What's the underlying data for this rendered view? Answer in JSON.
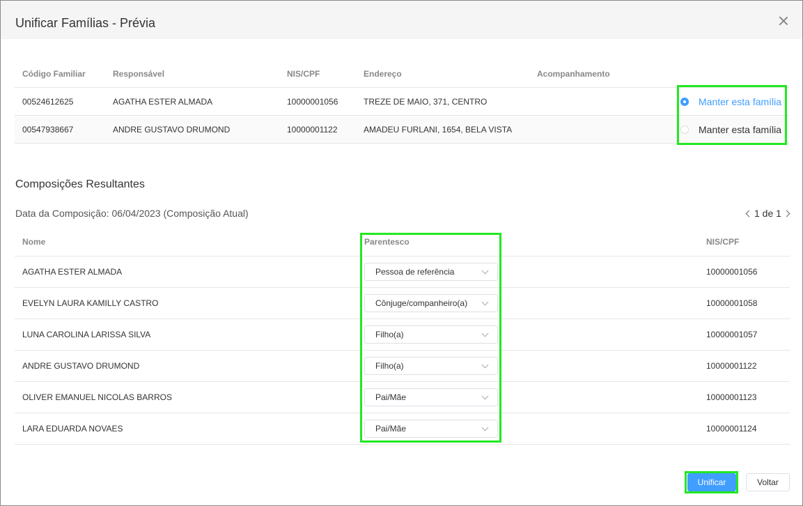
{
  "dialog": {
    "title": "Unificar Famílias - Prévia"
  },
  "families": {
    "headers": {
      "code": "Código Familiar",
      "responsible": "Responsável",
      "nis": "NIS/CPF",
      "address": "Endereço",
      "tracking": "Acompanhamento"
    },
    "rows": [
      {
        "code": "00524612625",
        "responsible": "AGATHA ESTER ALMADA",
        "nis": "10000001056",
        "address": "TREZE DE MAIO, 371, CENTRO",
        "tracking": "",
        "keep_label": "Manter esta família",
        "selected": true
      },
      {
        "code": "00547938667",
        "responsible": "ANDRE GUSTAVO DRUMOND",
        "nis": "10000001122",
        "address": "AMADEU FURLANI, 1654, BELA VISTA",
        "tracking": "",
        "keep_label": "Manter esta família",
        "selected": false
      }
    ]
  },
  "compositions": {
    "title": "Composições Resultantes",
    "date_label": "Data da Composição: 06/04/2023 (Composição Atual)",
    "pager": "1 de 1",
    "headers": {
      "name": "Nome",
      "relation": "Parentesco",
      "nis": "NIS/CPF"
    },
    "members": [
      {
        "name": "AGATHA ESTER ALMADA",
        "relation": "Pessoa de referência",
        "nis": "10000001056"
      },
      {
        "name": "EVELYN LAURA KAMILLY CASTRO",
        "relation": "Cônjuge/companheiro(a)",
        "nis": "10000001058"
      },
      {
        "name": "LUNA CAROLINA LARISSA SILVA",
        "relation": "Filho(a)",
        "nis": "10000001057"
      },
      {
        "name": "ANDRE GUSTAVO DRUMOND",
        "relation": "Filho(a)",
        "nis": "10000001122"
      },
      {
        "name": "OLIVER EMANUEL NICOLAS BARROS",
        "relation": "Pai/Mãe",
        "nis": "10000001123"
      },
      {
        "name": "LARA EDUARDA NOVAES",
        "relation": "Pai/Mãe",
        "nis": "10000001124"
      }
    ]
  },
  "footer": {
    "primary_label": "Unificar",
    "secondary_label": "Voltar"
  },
  "colors": {
    "accent": "#409eff",
    "highlight": "#22e822"
  }
}
